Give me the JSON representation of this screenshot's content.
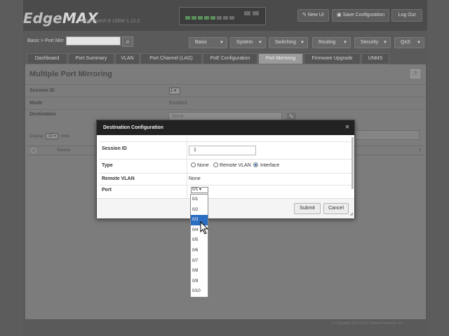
{
  "header": {
    "logo_brand": "Edge",
    "logo_max": "MAX",
    "device": "EdgeSwitch 8 150W 1.12.2",
    "buttons": {
      "new_ui": "New UI",
      "save": "Save Configuration",
      "logout": "Log Out"
    }
  },
  "nav": {
    "breadcrumb": "Basic > Port Mirr",
    "search_icon": "search-icon",
    "menus": [
      "Basic",
      "System",
      "Switching",
      "Routing",
      "Security",
      "QoS"
    ]
  },
  "tabs": [
    "Dashboard",
    "Port Summary",
    "VLAN",
    "Port Channel (LAG)",
    "PoE Configuration",
    "Port Mirroring",
    "Firmware Upgrade",
    "UNMS"
  ],
  "active_tab": "Port Mirroring",
  "content": {
    "title": "Multiple Port Mirroring",
    "help": "?",
    "fields": {
      "session_id_label": "Session ID",
      "session_id_value": "1",
      "mode_label": "Mode",
      "mode_value": "Enabled",
      "destination_label": "Destination",
      "destination_value": "None"
    },
    "display_label": "Display",
    "display_value": "All",
    "rows_label": "rows",
    "table_col_source": "Source",
    "footer": "© Copyright 2013-2025 Ubiquiti Networks, Inc."
  },
  "dialog": {
    "title": "Destination Configuration",
    "close_icon": "close-icon",
    "session_id_label": "Session ID",
    "session_id_value": "1",
    "type_label": "Type",
    "type_options": [
      "None",
      "Remote VLAN",
      "Interface"
    ],
    "type_selected": "Interface",
    "remote_vlan_label": "Remote VLAN",
    "remote_vlan_value": "None",
    "port_label": "Port",
    "port_value": "0/1",
    "submit": "Submit",
    "cancel": "Cancel"
  },
  "port_dropdown": {
    "options": [
      "0/1",
      "0/2",
      "0/3",
      "0/4",
      "0/5",
      "0/6",
      "0/7",
      "0/8",
      "0/9",
      "0/10"
    ],
    "highlighted": "0/3"
  }
}
